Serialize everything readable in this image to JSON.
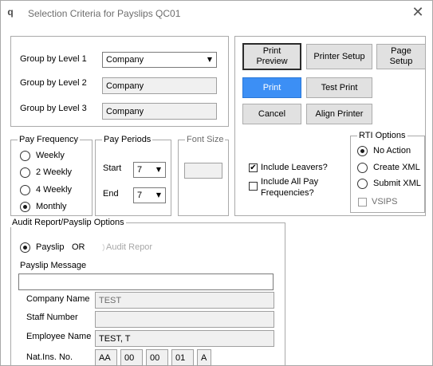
{
  "window": {
    "title": "Selection Criteria for Payslips QC01",
    "app_icon": "q"
  },
  "group_by": {
    "level1_label": "Group by Level 1",
    "level1_value": "Company",
    "level2_label": "Group by Level 2",
    "level2_value": "Company",
    "level3_label": "Group by Level 3",
    "level3_value": "Company"
  },
  "buttons": {
    "print_preview": "Print Preview",
    "printer_setup": "Printer Setup",
    "page_setup": "Page Setup",
    "print": "Print",
    "test_print": "Test Print",
    "cancel": "Cancel",
    "align_printer": "Align Printer"
  },
  "pay_frequency": {
    "legend": "Pay Frequency",
    "options": [
      "Weekly",
      "2 Weekly",
      "4 Weekly",
      "Monthly"
    ],
    "selected": "Monthly"
  },
  "pay_periods": {
    "legend": "Pay Periods",
    "start_label": "Start",
    "start_value": "7",
    "end_label": "End",
    "end_value": "7"
  },
  "font_size": {
    "legend": "Font Size",
    "value": ""
  },
  "options": {
    "include_leavers": "Include Leavers?",
    "include_leavers_checked": true,
    "include_all_freq": "Include All Pay Frequencies?",
    "include_all_freq_checked": false
  },
  "rti": {
    "legend": "RTI Options",
    "options": [
      "No Action",
      "Create XML",
      "Submit XML"
    ],
    "selected": "No Action",
    "vsips_label": "VSIPS",
    "vsips_checked": false
  },
  "audit": {
    "legend": "Audit Report/Payslip Options",
    "payslip_label": "Payslip",
    "or_label": "OR",
    "audit_label": "Audit Repor",
    "payslip_message_label": "Payslip Message",
    "payslip_message_value": "",
    "company_name_label": "Company Name",
    "company_name_value": "TEST",
    "staff_number_label": "Staff Number",
    "staff_number_value": "",
    "employee_name_label": "Employee Name",
    "employee_name_value": "TEST, T",
    "nat_ins_label": "Nat.Ins. No.",
    "nat_ins_parts": [
      "AA",
      "00",
      "00",
      "01",
      "A"
    ]
  }
}
